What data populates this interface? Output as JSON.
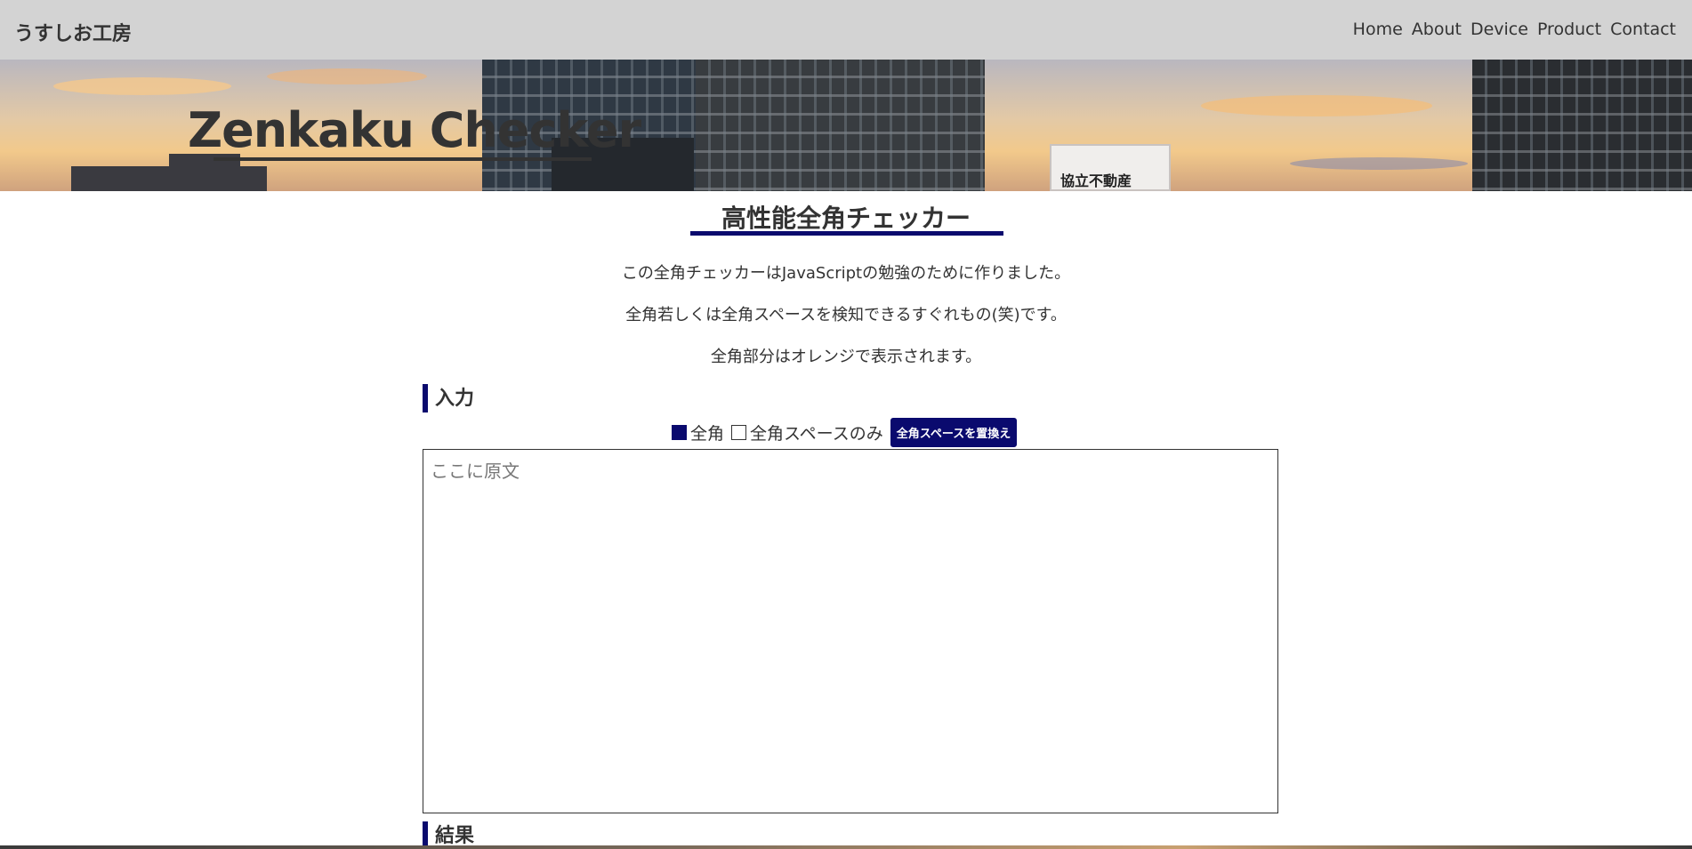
{
  "header": {
    "brand": "うすしお工房",
    "nav": [
      "Home",
      "About",
      "Device",
      "Product",
      "Contact"
    ]
  },
  "hero": {
    "title": "Zenkaku Checker",
    "sign_text": "協立不動産"
  },
  "main": {
    "title": "高性能全角チェッカー",
    "descriptions": [
      "この全角チェッカーはJavaScriptの勉強のために作りました。",
      "全角若しくは全角スペースを検知できるすぐれもの(笑)です。",
      "全角部分はオレンジで表示されます。"
    ],
    "input_heading": "入力",
    "options": {
      "zenkaku_label": "全角",
      "zenkaku_checked": true,
      "space_only_label": "全角スペースのみ",
      "space_only_checked": false,
      "replace_button": "全角スペースを置換え"
    },
    "input_placeholder": "ここに原文",
    "result_heading": "結果"
  },
  "colors": {
    "accent": "#0a0a6e",
    "navbar_bg": "#d3d3d3",
    "text": "#333333"
  }
}
